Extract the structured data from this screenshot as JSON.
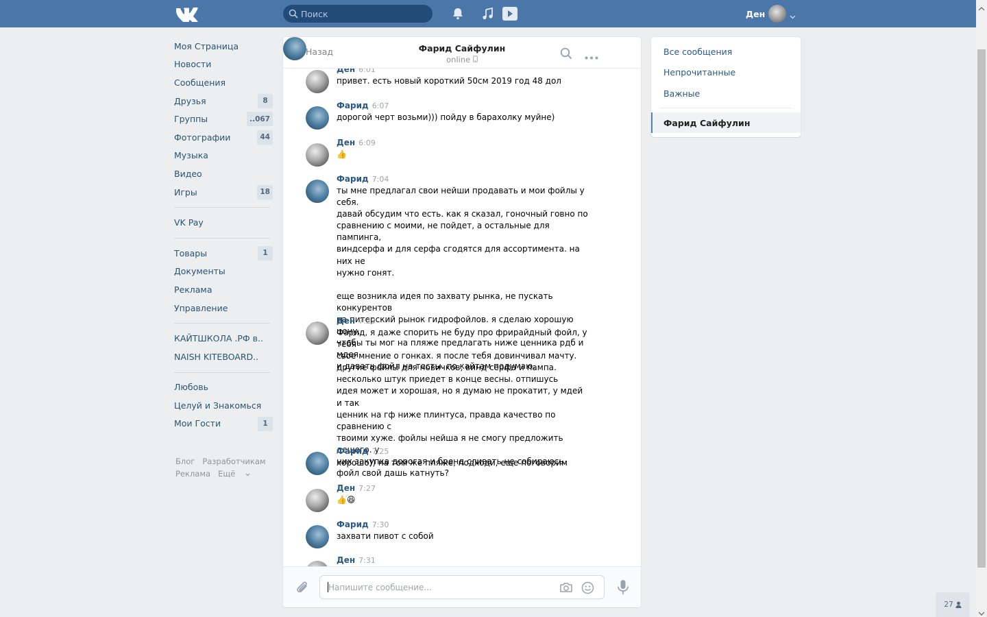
{
  "header": {
    "search_placeholder": "Поиск",
    "user_name": "Ден",
    "brand_color": "#4a76a8"
  },
  "left_menu": {
    "group1": [
      {
        "label": "Моя Страница",
        "icon": "home-icon",
        "count": ""
      },
      {
        "label": "Новости",
        "icon": "news-icon",
        "count": ""
      },
      {
        "label": "Сообщения",
        "icon": "message-icon",
        "count": ""
      },
      {
        "label": "Друзья",
        "icon": "user-icon",
        "count": "8"
      },
      {
        "label": "Группы",
        "icon": "users-icon",
        "count": "..067"
      },
      {
        "label": "Фотографии",
        "icon": "camera-icon",
        "count": "44"
      },
      {
        "label": "Музыка",
        "icon": "music-icon",
        "count": ""
      },
      {
        "label": "Видео",
        "icon": "video-icon",
        "count": ""
      },
      {
        "label": "Игры",
        "icon": "gamepad-icon",
        "count": "18"
      }
    ],
    "group2": [
      {
        "label": "VK Pay",
        "icon": "vkpay-icon",
        "count": ""
      }
    ],
    "group3": [
      {
        "label": "Товары",
        "icon": "bag-icon",
        "count": "1"
      },
      {
        "label": "Документы",
        "icon": "document-icon",
        "count": ""
      },
      {
        "label": "Реклама",
        "icon": "megaphone-icon",
        "count": ""
      },
      {
        "label": "Управление",
        "icon": "gamepad-icon",
        "count": ""
      }
    ],
    "group4": [
      {
        "label": "КАЙТШКОЛА .РФ в..",
        "icon": "users-icon",
        "count": ""
      },
      {
        "label": "NAISH KITEBOARD..",
        "icon": "users-icon",
        "count": ""
      }
    ],
    "group5": [
      {
        "label": "Любовь",
        "icon": "apps-icon",
        "count": ""
      },
      {
        "label": "Целуй и Знакомься",
        "icon": "apps-icon",
        "count": ""
      },
      {
        "label": "Мои Гости",
        "icon": "apps-icon",
        "count": "1"
      }
    ],
    "footer": {
      "blog": "Блог",
      "developers": "Разработчикам",
      "ads": "Реклама",
      "more": "Ещё"
    }
  },
  "chat": {
    "back_label": "Назад",
    "title": "Фарид Сайфулин",
    "status": "online",
    "input_placeholder": "Напишите сообщение...",
    "messages": [
      {
        "author": "Ден",
        "time": "6:01",
        "text": "привет. есть новый короткий 50см 2019 год 48 дол"
      },
      {
        "author": "Фарид",
        "time": "6:07",
        "text": "дорогой черт возьми))) пойду в барахолку муйне)"
      },
      {
        "author": "Ден",
        "time": "6:09",
        "text": "👍"
      },
      {
        "author": "Фарид",
        "time": "7:04",
        "text": "ты мне предлагал свои нейши продавать и мои фойлы у себя.\nдавай обсудим что есть. как я сказал, гоночный говно по\nсравнению с моими, не пойдет, а остальные для пампинга,\nвиндсерфа и для серфа сгодятся для ассортимента. на них не\nнужно гонят.\n\nеще возникла идея по захвату рынка, не пускать конкурентов\nна питерский рынок гидрофойлов. я сделаю хорошую цену,\nчтобы ты мог на пляже предлагать ниже ценника рдб и мдея.\nи давать фойл на тесты. по кайтам подумаю."
      },
      {
        "author": "Ден",
        "time": "7:23",
        "text": "Фарид, я даже спорить не буду про фрирайдный фойл, у тебя\nсвое мнение о гонках. я после тебя довинчивал мачту.\nдругие фойлы для новичков, винд серфа и пампа.\nнесколько штук приедет в конце весны. отпишусь\nидея может и хорошая, но я думаю не прокатит, у мдей и так\nценник на гф ниже плинтуса, правда качество по сравнению с\nтвоими хуже. фойлы нейша я не смогу предложить дешего. у\nних закупка дорогая и бренд сливать не собираюсь.\nфойл свой дашь катнуть?"
      },
      {
        "author": "Фарид",
        "time": "7:25",
        "text": "хорошо)) на том же пляже, подходи, еще поговорим"
      },
      {
        "author": "Ден",
        "time": "7:27",
        "text": "👍😆"
      },
      {
        "author": "Фарид",
        "time": "7:30",
        "text": "захвати пивот с собой"
      },
      {
        "author": "Ден",
        "time": "7:31",
        "text": ""
      }
    ]
  },
  "right_panel": {
    "all_messages": "Все сообщения",
    "unread": "Непрочитанные",
    "important": "Важные",
    "selected_chat": "Фарид Сайфулин"
  },
  "online_friends_count": "27"
}
